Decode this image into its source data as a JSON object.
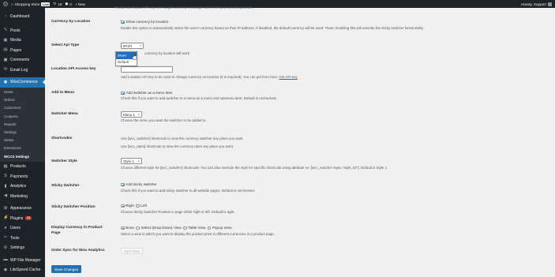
{
  "adminbar": {
    "site_name": "Shopping Store",
    "live_badge": "Live",
    "updates_count": "19",
    "comments_count": "0",
    "new_label": "+ New",
    "howdy": "Howdy, Support"
  },
  "sidebar": {
    "top": [
      {
        "label": "Dashboard",
        "icon": "dashboard-icon",
        "glyph": "◔"
      }
    ],
    "items_a": [
      {
        "label": "Posts",
        "icon": "pin-icon",
        "glyph": "✎"
      },
      {
        "label": "Media",
        "icon": "media-icon",
        "glyph": "▣"
      },
      {
        "label": "Pages",
        "icon": "pages-icon",
        "glyph": "▤"
      },
      {
        "label": "Comments",
        "icon": "comments-icon",
        "glyph": "◼"
      },
      {
        "label": "Email Log",
        "icon": "email-icon",
        "glyph": "✉"
      }
    ],
    "woocommerce": {
      "label": "WooCommerce",
      "icon": "woocommerce-icon",
      "glyph": "◉"
    },
    "woo_sub": [
      "Home",
      "Orders",
      "Customers",
      "Coupons",
      "Reports",
      "Settings",
      "Status",
      "Extensions",
      "WCCS Settings"
    ],
    "items_b": [
      {
        "label": "Products",
        "icon": "products-icon",
        "glyph": "▦"
      },
      {
        "label": "Payments",
        "icon": "payments-icon",
        "glyph": "$"
      },
      {
        "label": "Analytics",
        "icon": "analytics-icon",
        "glyph": "▮"
      },
      {
        "label": "Marketing",
        "icon": "marketing-icon",
        "glyph": "◀"
      }
    ],
    "items_c": [
      {
        "label": "Appearance",
        "icon": "appearance-icon",
        "glyph": "✿"
      },
      {
        "label": "Plugins",
        "icon": "plugins-icon",
        "glyph": "⚡",
        "badge": "19"
      },
      {
        "label": "Users",
        "icon": "users-icon",
        "glyph": "●"
      },
      {
        "label": "Tools",
        "icon": "tools-icon",
        "glyph": "✂"
      },
      {
        "label": "Settings",
        "icon": "settings-icon",
        "glyph": "⚙"
      }
    ],
    "items_d": [
      {
        "label": "WP File Manager",
        "icon": "file-manager-icon",
        "glyph": "▬"
      },
      {
        "label": "LiteSpeed Cache",
        "icon": "litespeed-icon",
        "glyph": "◆"
      }
    ]
  },
  "settings": {
    "clipped_desc": "Please insert your API key here to get currency exchange rates from your chosen provider.",
    "currency_by_location": {
      "label": "Currency by Location",
      "checkbox_label": "Show currency by location",
      "desc": "Enable this option to automatically select the user's currency based on their IP address. If disabled, the default currency will be used. *Note: Enabling this will override the sticky switcher functionality."
    },
    "select_api_type": {
      "label": "Select Api Type",
      "selected": "IPAPI",
      "desc_visible": "currency by location will work.",
      "options": [
        "IPAPI",
        "Default"
      ]
    },
    "location_api_key": {
      "label": "Location API Access key",
      "value": "",
      "desc": "Add Location API key to be used to change currency on location (it is required). You can get from here:",
      "link": "Get API key"
    },
    "add_to_menu": {
      "label": "Add to Menu",
      "checkbox_label": "Add switcher as a menu item",
      "desc": "Check this if you want to add switcher to a menu as a menu and submenu item. Default is unchecked."
    },
    "switcher_menu": {
      "label": "Switcher Menu",
      "selected": "Menu 1",
      "desc": "Choose the menu you want the switcher to be added to."
    },
    "shortcodes": {
      "label": "Shortcodes",
      "line1": "Use [wcc_switcher] shortcode to view the currency switcher any place you want.",
      "line2": "Use [wcc_rates] shortcode to view the currency rates any place you want."
    },
    "switcher_style": {
      "label": "Switcher Style",
      "selected": "Style 1",
      "desc": "Choose different style for [wcc_switcher] shortcode. You can also override the style for specific shortcode using attribute ex: [wcc_switcher style=\"style_02\"]. Default is Style 1."
    },
    "sticky_switcher": {
      "label": "Sticky Switcher",
      "checkbox_label": "Add sticky switcher",
      "desc": "Check this if you want to add sticky switcher to all website pages. Default is unchecked."
    },
    "sticky_position": {
      "label": "Sticky Switcher Position",
      "options": [
        "Right",
        "Left"
      ],
      "selected": "Right",
      "desc": "Choose Sticky Switcher Position in page either right or left. Default is right."
    },
    "display_currency": {
      "label": "Display Currency in Product Page",
      "options": [
        "None",
        "Select (Drop Down) View",
        "Table View",
        "Popup View"
      ],
      "selected": "None",
      "desc": "Select a view in which you want to display the product price in different currencies in a product page."
    },
    "order_sync": {
      "label": "Order Sync for Woo Analytics",
      "button": "Sync Now"
    },
    "save_button": "Save Changes"
  }
}
